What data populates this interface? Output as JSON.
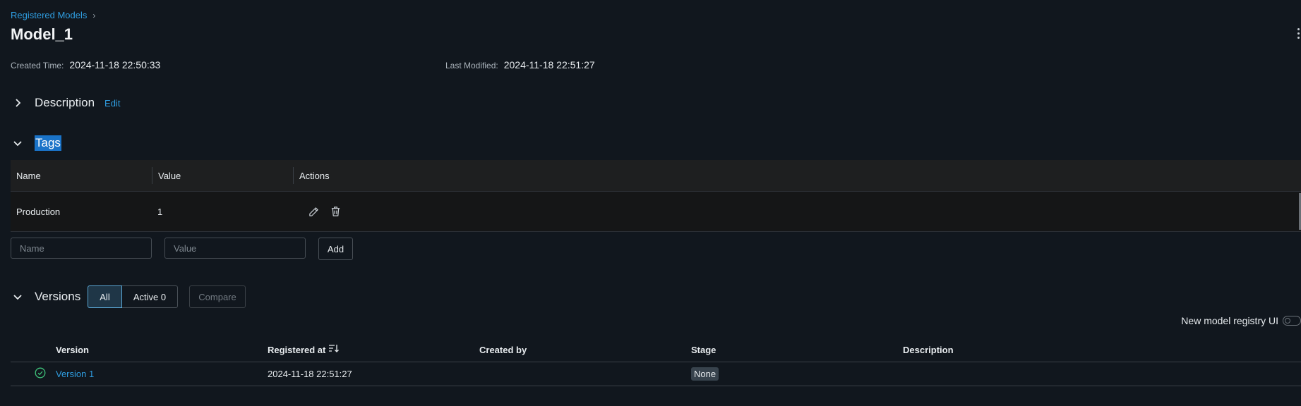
{
  "breadcrumb": {
    "parent": "Registered Models",
    "separator": "›"
  },
  "title": "Model_1",
  "meta": {
    "created_label": "Created Time:",
    "created_value": "2024-11-18 22:50:33",
    "modified_label": "Last Modified:",
    "modified_value": "2024-11-18 22:51:27"
  },
  "description": {
    "title": "Description",
    "edit_label": "Edit"
  },
  "tags": {
    "title": "Tags",
    "columns": [
      "Name",
      "Value",
      "Actions"
    ],
    "rows": [
      {
        "name": "Production",
        "value": "1"
      }
    ],
    "name_placeholder": "Name",
    "value_placeholder": "Value",
    "add_label": "Add"
  },
  "versions": {
    "title": "Versions",
    "filter_all": "All",
    "filter_active": "Active 0",
    "compare_label": "Compare",
    "toggle_label": "New model registry UI",
    "columns": [
      "Version",
      "Registered at",
      "Created by",
      "Stage",
      "Description"
    ],
    "rows": [
      {
        "version": "Version 1",
        "registered_at": "2024-11-18 22:51:27",
        "created_by": "",
        "stage": "None",
        "description": ""
      }
    ]
  },
  "colors": {
    "background": "#11171e",
    "link": "#2f9de0",
    "highlight": "#1a73c8",
    "status_ok": "#3ec27a"
  }
}
